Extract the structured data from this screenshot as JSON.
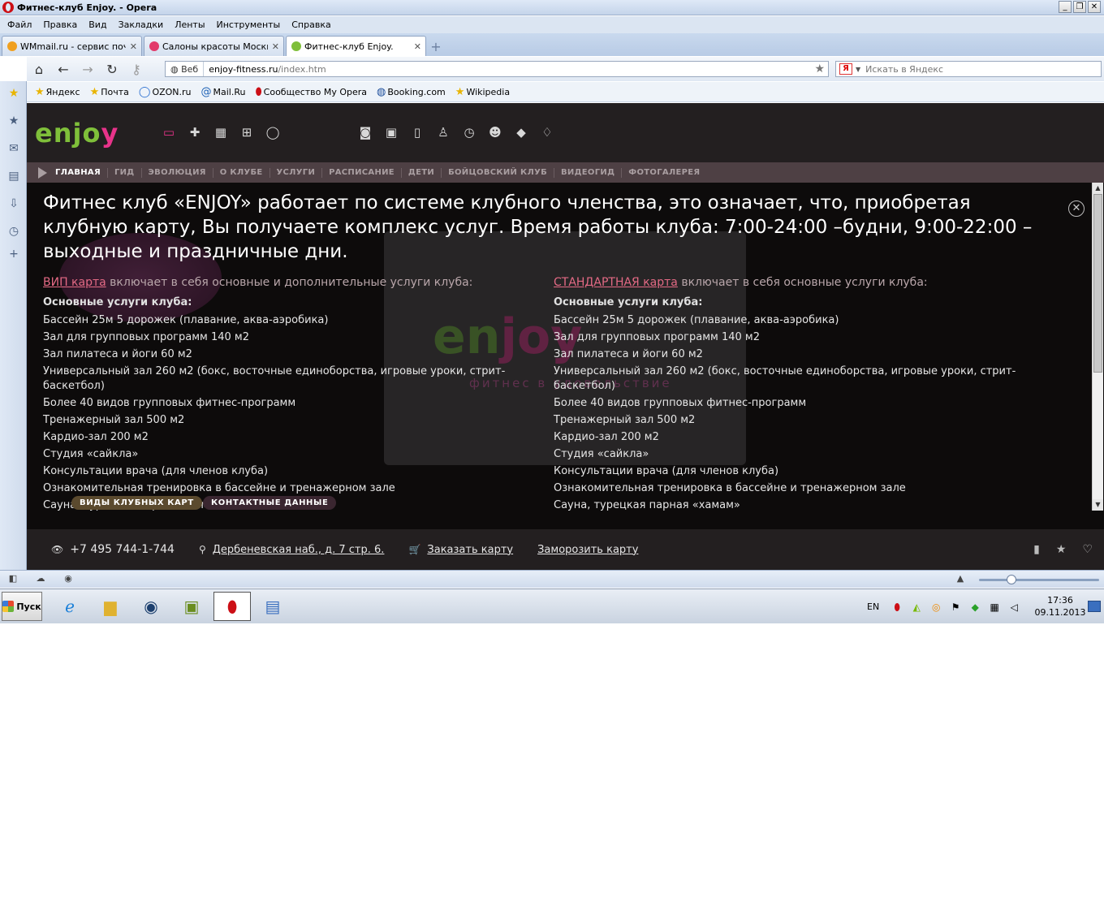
{
  "window": {
    "title": "Фитнес-клуб Enjoy. - Opera",
    "buttons": [
      "_",
      "❐",
      "✕"
    ]
  },
  "menu": [
    "Файл",
    "Правка",
    "Вид",
    "Закладки",
    "Ленты",
    "Инструменты",
    "Справка"
  ],
  "tabs": [
    {
      "label": "WMmail.ru - сервис поч…",
      "icon_color": "#f0a020",
      "active": false
    },
    {
      "label": "Салоны красоты Москв…",
      "icon_color": "#e23a6a",
      "active": false
    },
    {
      "label": "Фитнес-клуб Enjoy.",
      "icon_color": "#7fbf3a",
      "active": true
    }
  ],
  "address": {
    "web_label": "Веб",
    "url_host": "enjoy-fitness.ru",
    "url_path": "/index.htm",
    "search_placeholder": "Искать в Яндекс",
    "search_engine_badge": "Я"
  },
  "bookmarks": [
    {
      "label": "Яндекс",
      "icon": "star-icon"
    },
    {
      "label": "Почта",
      "icon": "star-icon"
    },
    {
      "label": "OZON.ru",
      "icon": "ozon-icon"
    },
    {
      "label": "Mail.Ru",
      "icon": "at-icon"
    },
    {
      "label": "Сообщество My Opera",
      "icon": "opera-icon"
    },
    {
      "label": "Booking.com",
      "icon": "globe-icon"
    },
    {
      "label": "Wikipedia",
      "icon": "star-icon"
    }
  ],
  "site": {
    "logo_part1": "enjo",
    "logo_part2": "y",
    "nav": [
      "ГЛАВНАЯ",
      "ГИД",
      "ЭВОЛЮЦИЯ",
      "О КЛУБЕ",
      "УСЛУГИ",
      "РАСПИСАНИЕ",
      "ДЕТИ",
      "БОЙЦОВСКИЙ КЛУБ",
      "ВИДЕОГИД",
      "ФОТОГАЛЕРЕЯ"
    ],
    "intro": "Фитнес клуб «ENJOY» работает по системе клубного членства, это означает, что, приобретая клубную карту, Вы получаете комплекс услуг. Время работы клуба: 7:00-24:00 –будни, 9:00-22:00 – выходные и праздничные дни.",
    "bg_watermark_a": "en",
    "bg_watermark_b": "joy",
    "bg_watermark_sub": "фитнес в удовольствие",
    "vip": {
      "link": "ВИП карта",
      "head_rest": " включает в себя основные и дополнительные услуги клуба:",
      "sub": "Основные услуги клуба:",
      "items": [
        "Бассейн 25м 5 дорожек (плавание, аква-аэробика)",
        "Зал для групповых программ 140 м2",
        "Зал пилатеса и йоги 60 м2",
        "Универсальный зал 260 м2 (бокс, восточные единоборства, игровые уроки, стрит-баскетбол)",
        "Более 40 видов групповых фитнес-программ",
        "Тренажерный зал 500 м2",
        "Кардио-зал 200 м2",
        "Студия «сайкла»",
        "Консультации врача (для членов клуба)",
        "Ознакомительная тренировка в бассейне и тренажерном зале",
        "Сауна, турецкая парная «хамам»"
      ]
    },
    "standard": {
      "link": "СТАНДАРТНАЯ карта",
      "head_rest": " включает в себя основные услуги клуба:",
      "sub": "Основные услуги клуба:",
      "items": [
        "Бассейн 25м 5 дорожек (плавание, аква-аэробика)",
        "Зал для групповых программ 140 м2",
        "Зал пилатеса и йоги 60 м2",
        "Универсальный зал 260 м2 (бокс, восточные единоборства, игровые уроки, стрит-баскетбол)",
        "Более 40 видов групповых фитнес-программ",
        "Тренажерный зал 500 м2",
        "Кардио-зал 200 м2",
        "Студия «сайкла»",
        "Консультации врача (для членов клуба)",
        "Ознакомительная тренировка в бассейне и тренажерном зале",
        "Сауна, турецкая парная «хамам»"
      ]
    },
    "pills": [
      "ВИДЫ КЛУБНЫХ КАРТ",
      "КОНТАКТНЫЕ ДАННЫЕ"
    ],
    "footer": {
      "phone": "+7 495 744-1-744",
      "address": "Дербеневская наб., д. 7 стр. 6.",
      "order": "Заказать карту",
      "freeze": "Заморозить карту"
    }
  },
  "taskbar": {
    "start": "Пуск",
    "lang": "EN",
    "time": "17:36",
    "date": "09.11.2013"
  },
  "colors": {
    "brand_green": "#7fbf3a",
    "brand_pink": "#e8338a",
    "link_pink": "#e46a85"
  }
}
